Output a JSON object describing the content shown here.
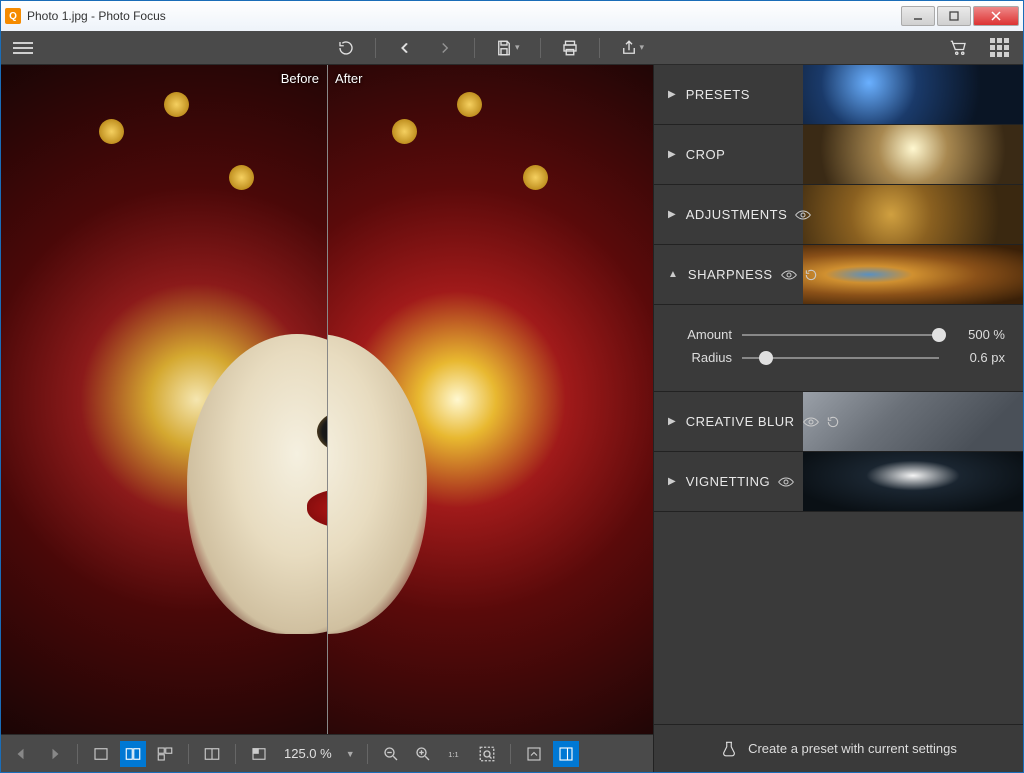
{
  "window": {
    "title": "Photo 1.jpg - Photo Focus"
  },
  "toolbar": {
    "menu": "menu",
    "revert": "revert",
    "undo": "undo",
    "redo": "redo",
    "save": "save",
    "print": "print",
    "share": "share",
    "cart": "cart",
    "thumbs": "thumbnails"
  },
  "preview": {
    "before": "Before",
    "after": "After"
  },
  "panels": {
    "presets": {
      "title": "PRESETS"
    },
    "crop": {
      "title": "CROP"
    },
    "adjustments": {
      "title": "ADJUSTMENTS"
    },
    "sharpness": {
      "title": "SHARPNESS",
      "amount_label": "Amount",
      "amount_value": "500 %",
      "amount_pct": 100,
      "radius_label": "Radius",
      "radius_value": "0.6 px",
      "radius_pct": 12
    },
    "creative_blur": {
      "title": "CREATIVE BLUR"
    },
    "vignetting": {
      "title": "VIGNETTING"
    }
  },
  "footer": {
    "create_preset": "Create a preset with current settings"
  },
  "bottom": {
    "zoom": "125.0 %"
  }
}
